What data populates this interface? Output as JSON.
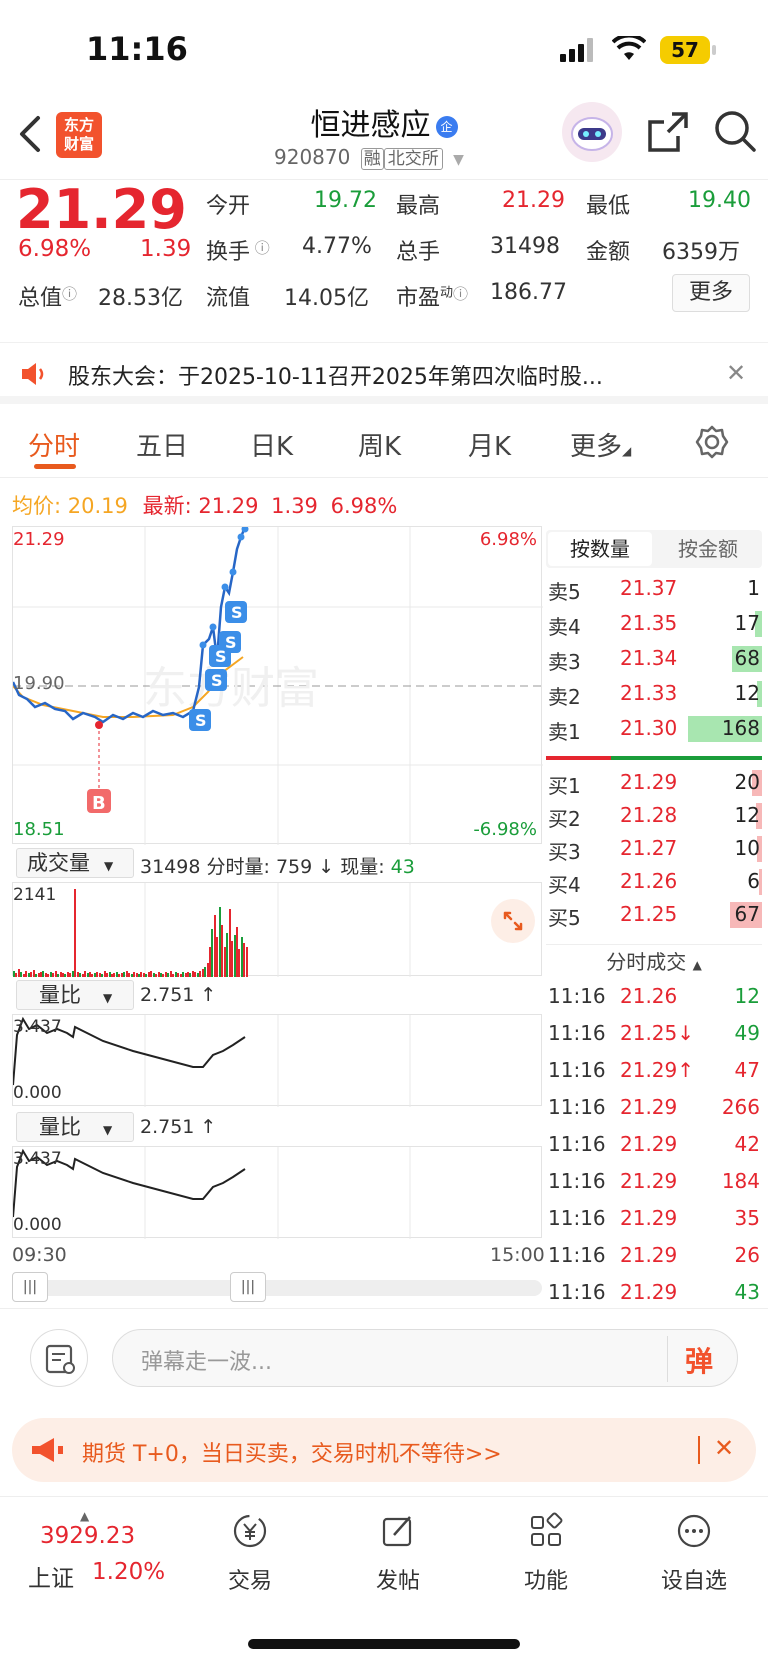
{
  "status_bar": {
    "time": "11:16",
    "battery": "57"
  },
  "header": {
    "logo_line1": "东方",
    "logo_line2": "财富",
    "stock_name": "恒进感应",
    "badge": "企",
    "code": "920870",
    "tag_margin": "融",
    "exchange": "北交所"
  },
  "quote": {
    "price": "21.29",
    "change_pct": "6.98%",
    "change": "1.39",
    "open_label": "今开",
    "open": "19.72",
    "high_label": "最高",
    "high": "21.29",
    "low_label": "最低",
    "low": "19.40",
    "turnover_label": "换手",
    "turnover": "4.77%",
    "volume_label": "总手",
    "volume": "31498",
    "amount_label": "金额",
    "amount": "6359万",
    "mktcap_label": "总值",
    "mktcap": "28.53亿",
    "float_label": "流值",
    "float": "14.05亿",
    "pe_label": "市盈",
    "pe_sup": "动",
    "pe": "186.77",
    "more_label": "更多"
  },
  "notice": {
    "text": "股东大会：于2025-10-11召开2025年第四次临时股..."
  },
  "tabs": [
    "分时",
    "五日",
    "日K",
    "周K",
    "月K",
    "更多"
  ],
  "intraday": {
    "avg_label": "均价:",
    "avg": "20.19",
    "latest_label": "最新:",
    "latest": "21.29",
    "chg": "1.39",
    "pct": "6.98%",
    "y_top": "21.29",
    "y_mid": "19.90",
    "y_bottom": "18.51",
    "pct_top": "6.98%",
    "pct_bottom": "-6.98%",
    "watermark": "东方财富",
    "buy_marker": "B",
    "sell_marker": "S",
    "volume_selector": "成交量",
    "volume_total": "31498",
    "volume_detail": "分时量: 759 ↓ 现量: ",
    "volume_now": "43",
    "volume_max": "2141",
    "ratio_selector": "量比",
    "ratio_value": "2.751 ↑",
    "ratio_max": "3.437",
    "ratio_min": "0.000",
    "time_start": "09:30",
    "time_end": "15:00"
  },
  "order_book": {
    "tab_active": "按数量",
    "tab_other": "按金额",
    "asks": [
      {
        "label": "卖5",
        "price": "21.37",
        "qty": "1"
      },
      {
        "label": "卖4",
        "price": "21.35",
        "qty": "17"
      },
      {
        "label": "卖3",
        "price": "21.34",
        "qty": "68"
      },
      {
        "label": "卖2",
        "price": "21.33",
        "qty": "12"
      },
      {
        "label": "卖1",
        "price": "21.30",
        "qty": "168"
      }
    ],
    "bids": [
      {
        "label": "买1",
        "price": "21.29",
        "qty": "20"
      },
      {
        "label": "买2",
        "price": "21.28",
        "qty": "12"
      },
      {
        "label": "买3",
        "price": "21.27",
        "qty": "10"
      },
      {
        "label": "买4",
        "price": "21.26",
        "qty": "6"
      },
      {
        "label": "买5",
        "price": "21.25",
        "qty": "67"
      }
    ]
  },
  "ticks": {
    "title": "分时成交",
    "rows": [
      {
        "time": "11:16",
        "price": "21.26",
        "qty": "12",
        "dir": "",
        "qcolor": "green"
      },
      {
        "time": "11:16",
        "price": "21.25↓",
        "qty": "49",
        "dir": "",
        "qcolor": "green"
      },
      {
        "time": "11:16",
        "price": "21.29↑",
        "qty": "47",
        "dir": "",
        "qcolor": "red"
      },
      {
        "time": "11:16",
        "price": "21.29",
        "qty": "266",
        "dir": "",
        "qcolor": "red"
      },
      {
        "time": "11:16",
        "price": "21.29",
        "qty": "42",
        "dir": "",
        "qcolor": "red"
      },
      {
        "time": "11:16",
        "price": "21.29",
        "qty": "184",
        "dir": "",
        "qcolor": "red"
      },
      {
        "time": "11:16",
        "price": "21.29",
        "qty": "35",
        "dir": "",
        "qcolor": "red"
      },
      {
        "time": "11:16",
        "price": "21.29",
        "qty": "26",
        "dir": "",
        "qcolor": "red"
      },
      {
        "time": "11:16",
        "price": "21.29",
        "qty": "43",
        "dir": "",
        "qcolor": "green"
      }
    ]
  },
  "comment": {
    "placeholder": "弹幕走一波...",
    "danmu_button": "弹"
  },
  "ad": {
    "text": "期货 T+0，当日买卖，交易时机不等待>>"
  },
  "bottom_nav": {
    "index_value": "3929.23",
    "index_name": "上证",
    "index_pct": "1.20%",
    "items": [
      "交易",
      "发帖",
      "功能",
      "设自选"
    ]
  }
}
